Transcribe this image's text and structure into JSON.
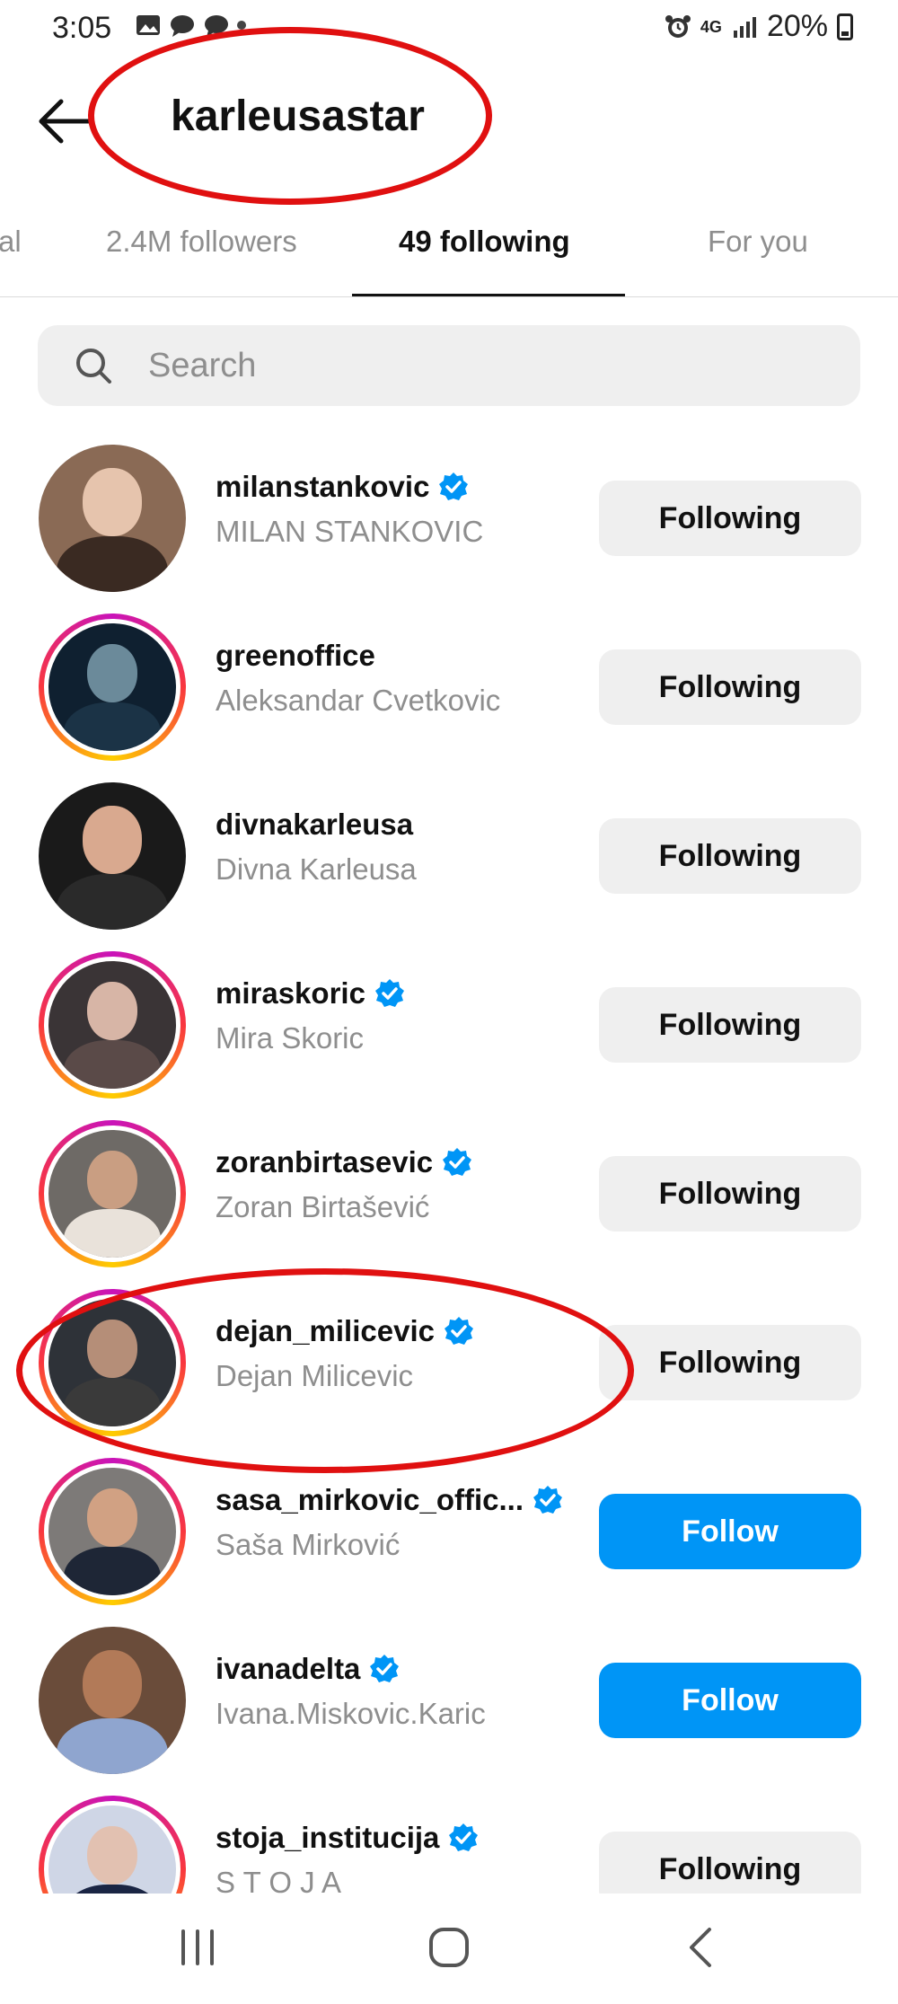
{
  "status_bar": {
    "time": "3:05",
    "network": "4G",
    "battery": "20%"
  },
  "header": {
    "username": "karleusastar"
  },
  "tabs": [
    {
      "label": "al"
    },
    {
      "label": "2.4M followers"
    },
    {
      "label": "49 following"
    },
    {
      "label": "For you"
    }
  ],
  "search": {
    "placeholder": "Search"
  },
  "accounts": [
    {
      "username": "milanstankovic",
      "full_name": "MILAN STANKOVIC",
      "verified": true,
      "story_ring": false,
      "action": "Following"
    },
    {
      "username": "greenoffice",
      "full_name": "Aleksandar Cvetkovic",
      "verified": false,
      "story_ring": true,
      "action": "Following"
    },
    {
      "username": "divnakarleusa",
      "full_name": "Divna Karleusa",
      "verified": false,
      "story_ring": false,
      "action": "Following"
    },
    {
      "username": "miraskoric",
      "full_name": "Mira Skoric",
      "verified": true,
      "story_ring": true,
      "action": "Following"
    },
    {
      "username": "zoranbirtasevic",
      "full_name": "Zoran Birtašević",
      "verified": true,
      "story_ring": true,
      "action": "Following"
    },
    {
      "username": "dejan_milicevic",
      "full_name": "Dejan Milicevic",
      "verified": true,
      "story_ring": true,
      "action": "Following"
    },
    {
      "username": "sasa_mirkovic_offic...",
      "full_name": "Saša Mirković",
      "verified": true,
      "story_ring": true,
      "action": "Follow"
    },
    {
      "username": "ivanadelta",
      "full_name": "Ivana.Miskovic.Karic",
      "verified": true,
      "story_ring": false,
      "action": "Follow"
    },
    {
      "username": "stoja_institucija",
      "full_name": "S T O J A",
      "verified": true,
      "story_ring": true,
      "action": "Following"
    }
  ],
  "colors": {
    "follow_blue": "#0095f6",
    "verified_blue": "#0095f6",
    "annotation_red": "#e01010"
  },
  "nav": {
    "items": [
      "recent-apps-icon",
      "home-icon",
      "back-icon"
    ]
  }
}
